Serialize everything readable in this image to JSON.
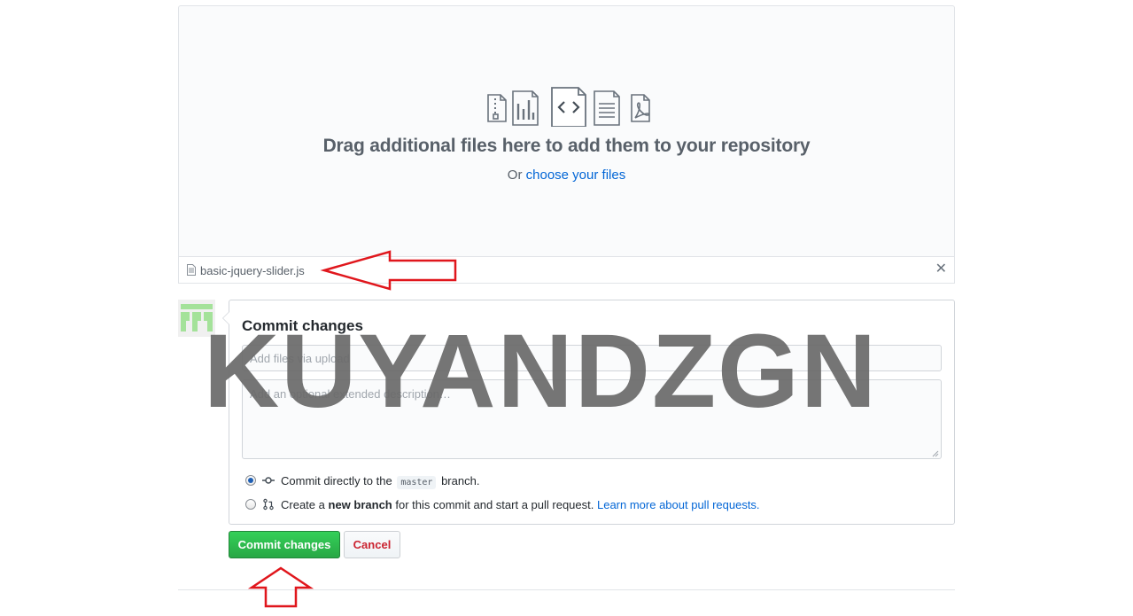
{
  "dropzone": {
    "title": "Drag additional files here to add them to your repository",
    "or_text": "Or",
    "choose_link": "choose your files",
    "file_type_icons": [
      "zip-file-icon",
      "chart-file-icon",
      "code-file-icon",
      "text-file-icon",
      "pdf-file-icon"
    ]
  },
  "uploaded_file": {
    "name": "basic-jquery-slider.js",
    "remove_symbol": "✕"
  },
  "commit": {
    "title": "Commit changes",
    "summary_placeholder": "Add files via upload",
    "description_placeholder": "Add an optional extended description…",
    "option_direct": {
      "prefix": "Commit directly to the",
      "branch": "master",
      "suffix": "branch.",
      "checked": true
    },
    "option_new_branch": {
      "prefix": "Create a",
      "bold": "new branch",
      "middle": "for this commit and start a pull request.",
      "link": "Learn more about pull requests.",
      "checked": false
    },
    "commit_button": "Commit changes",
    "cancel_button": "Cancel"
  },
  "watermark": "KUYANDZGN",
  "colors": {
    "link": "#0366d6",
    "commit_green": "#28a745",
    "cancel_red": "#cb2431",
    "annotation_red": "#e0161c",
    "avatar_green": "#a4e29a"
  }
}
